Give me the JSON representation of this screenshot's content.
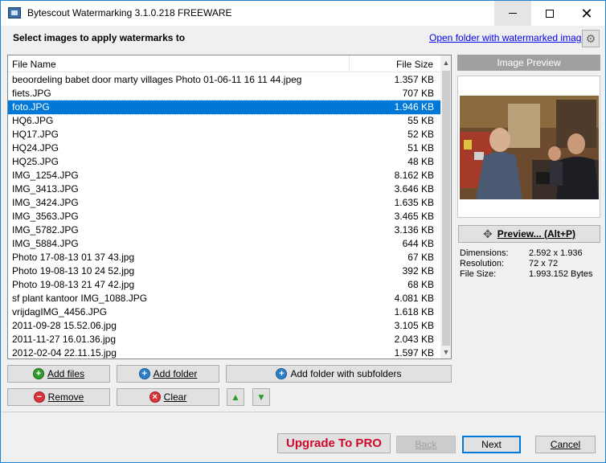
{
  "window": {
    "title": "Bytescout Watermarking 3.1.0.218 FREEWARE",
    "minimize": "minimize",
    "maximize": "maximize",
    "close": "close"
  },
  "header": {
    "label": "Select images to apply watermarks to",
    "open_folder_link": "Open folder with watermarked images"
  },
  "file_list": {
    "columns": [
      "File Name",
      "File Size"
    ],
    "selected_index": 2,
    "rows": [
      {
        "name": "beoordeling babet door marty villages Photo 01-06-11 16 11 44.jpeg",
        "size": "1.357 KB"
      },
      {
        "name": "fiets.JPG",
        "size": "707 KB"
      },
      {
        "name": "foto.JPG",
        "size": "1.946 KB"
      },
      {
        "name": "HQ6.JPG",
        "size": "55 KB"
      },
      {
        "name": "HQ17.JPG",
        "size": "52 KB"
      },
      {
        "name": "HQ24.JPG",
        "size": "51 KB"
      },
      {
        "name": "HQ25.JPG",
        "size": "48 KB"
      },
      {
        "name": "IMG_1254.JPG",
        "size": "8.162 KB"
      },
      {
        "name": "IMG_3413.JPG",
        "size": "3.646 KB"
      },
      {
        "name": "IMG_3424.JPG",
        "size": "1.635 KB"
      },
      {
        "name": "IMG_3563.JPG",
        "size": "3.465 KB"
      },
      {
        "name": "IMG_5782.JPG",
        "size": "3.136 KB"
      },
      {
        "name": "IMG_5884.JPG",
        "size": "644 KB"
      },
      {
        "name": "Photo 17-08-13 01 37 43.jpg",
        "size": "67 KB"
      },
      {
        "name": "Photo 19-08-13 10 24 52.jpg",
        "size": "392 KB"
      },
      {
        "name": "Photo 19-08-13 21 47 42.jpg",
        "size": "68 KB"
      },
      {
        "name": "sf plant kantoor IMG_1088.JPG",
        "size": "4.081 KB"
      },
      {
        "name": "vrijdagIMG_4456.JPG",
        "size": "1.618 KB"
      },
      {
        "name": "2011-09-28 15.52.06.jpg",
        "size": "3.105 KB"
      },
      {
        "name": "2011-11-27 16.01.36.jpg",
        "size": "2.043 KB"
      },
      {
        "name": "2012-02-04 22.11.15.jpg",
        "size": "1.597 KB"
      }
    ]
  },
  "buttons": {
    "add_files": "Add files",
    "add_folder": "Add folder",
    "add_folder_sub": "Add folder with subfolders",
    "remove": "Remove",
    "clear": "Clear",
    "move_up": "▲",
    "move_down": "▼"
  },
  "preview": {
    "header": "Image Preview",
    "button": "Preview... (Alt+P)",
    "info": [
      {
        "label": "Dimensions:",
        "value": "2.592 x 1.936"
      },
      {
        "label": "Resolution:",
        "value": "72 x 72"
      },
      {
        "label": "File Size:",
        "value": "1.993.152 Bytes"
      }
    ]
  },
  "footer": {
    "upgrade": "Upgrade To PRO",
    "back": "Back",
    "next": "Next",
    "cancel": "Cancel"
  },
  "colors": {
    "selection": "#0078d7",
    "upgrade_text": "#cc0b2d",
    "link": "#0000ee"
  }
}
